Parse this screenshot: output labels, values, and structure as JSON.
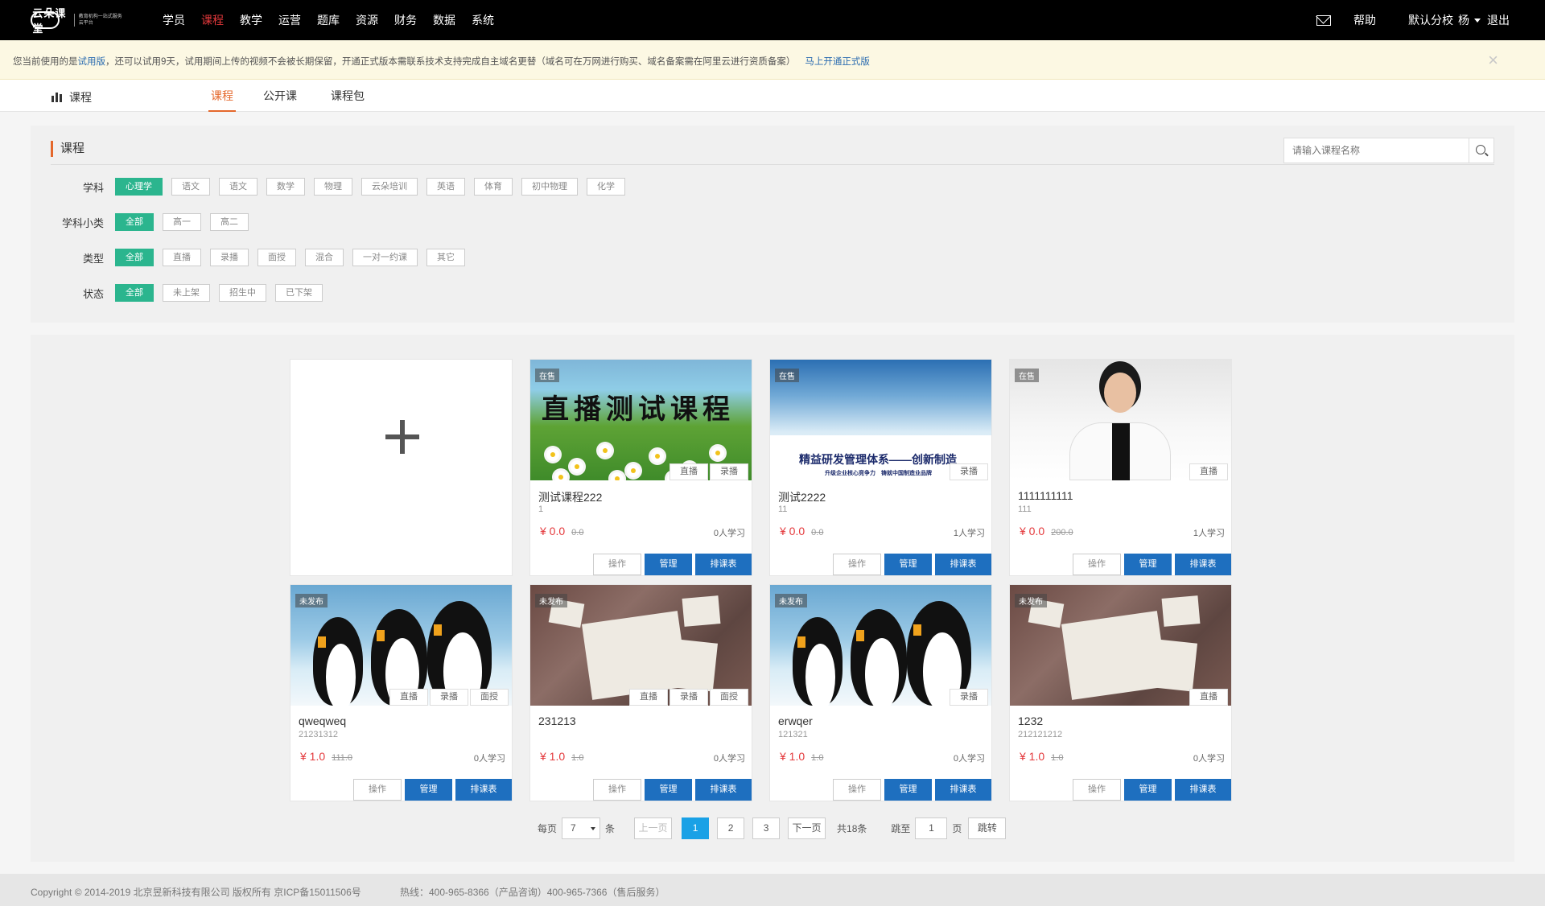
{
  "topbar": {
    "logo_text": "云朵课堂",
    "logo_sub": "教育机构一站式服务云平台",
    "nav": [
      "学员",
      "课程",
      "教学",
      "运营",
      "题库",
      "资源",
      "财务",
      "数据",
      "系统"
    ],
    "nav_active": "课程",
    "help": "帮助",
    "school": "默认分校",
    "user": "杨",
    "logout": "退出"
  },
  "notice": {
    "prefix": "您当前使用的是",
    "trial": "试用版",
    "text": "，还可以试用9天，试用期间上传的视频不会被长期保留，开通正式版本需联系技术支持完成自主域名更替（域名可在万网进行购买、域名备案需在阿里云进行资质备案）",
    "link": "马上开通正式版",
    "close": "×"
  },
  "subnav": {
    "title": "课程",
    "tabs": [
      "课程",
      "公开课",
      "课程包"
    ],
    "active": "课程"
  },
  "filter": {
    "title": "课程",
    "search_placeholder": "请输入课程名称",
    "rows": [
      {
        "label": "学科",
        "tags": [
          "心理学",
          "语文",
          "语文",
          "数学",
          "物理",
          "云朵培训",
          "英语",
          "体育",
          "初中物理",
          "化学"
        ],
        "active": 0
      },
      {
        "label": "学科小类",
        "tags": [
          "全部",
          "高一",
          "高二"
        ],
        "active": 0
      },
      {
        "label": "类型",
        "tags": [
          "全部",
          "直播",
          "录播",
          "面授",
          "混合",
          "一对一约课",
          "其它"
        ],
        "active": 0
      },
      {
        "label": "状态",
        "tags": [
          "全部",
          "未上架",
          "招生中",
          "已下架"
        ],
        "active": 0
      }
    ]
  },
  "courses": [
    {
      "name": "测试课程222",
      "sub": "1",
      "status": "在售",
      "tags": [
        "直播",
        "录播"
      ],
      "price": "¥ 0.0",
      "orig_price": "0.0",
      "learners": "0人学习",
      "art": "green",
      "banner": "直播测试课程"
    },
    {
      "name": "测试2222",
      "sub": "11",
      "status": "在售",
      "tags": [
        "录播"
      ],
      "price": "¥ 0.0",
      "orig_price": "0.0",
      "learners": "1人学习",
      "art": "sky",
      "banner": "精益研发管理体系——创新制造",
      "banner_sub": "升级企业核心竞争力　铸就中国制造业品牌"
    },
    {
      "name": "1111111111",
      "sub": "111",
      "status": "在售",
      "tags": [
        "直播"
      ],
      "price": "¥ 0.0",
      "orig_price": "200.0",
      "learners": "1人学习",
      "art": "woman"
    },
    {
      "name": "qweqweq",
      "sub": "21231312",
      "status": "未发布",
      "tags": [
        "直播",
        "录播",
        "面授"
      ],
      "price": "¥ 1.0",
      "orig_price": "111.0",
      "learners": "0人学习",
      "art": "penguin"
    },
    {
      "name": "231213",
      "sub": "",
      "status": "未发布",
      "tags": [
        "直播",
        "录播",
        "面授"
      ],
      "price": "¥ 1.0",
      "orig_price": "1.0",
      "learners": "0人学习",
      "art": "desk"
    },
    {
      "name": "erwqer",
      "sub": "121321",
      "status": "未发布",
      "tags": [
        "录播"
      ],
      "price": "¥ 1.0",
      "orig_price": "1.0",
      "learners": "0人学习",
      "art": "penguin"
    },
    {
      "name": "1232",
      "sub": "212121212",
      "status": "未发布",
      "tags": [
        "直播"
      ],
      "price": "¥ 1.0",
      "orig_price": "1.0",
      "learners": "0人学习",
      "art": "desk"
    }
  ],
  "card_actions": {
    "operate": "操作",
    "manage": "管理",
    "schedule": "排课表"
  },
  "pager": {
    "per_page_label": "每页",
    "per_page": "7",
    "unit": "条",
    "prev": "上一页",
    "pages": [
      "1",
      "2",
      "3"
    ],
    "current": "1",
    "next": "下一页",
    "total": "共18条",
    "jump_label": "跳至",
    "jump_value": "1",
    "page_unit": "页",
    "jump_btn": "跳转"
  },
  "footer": {
    "copyright": "Copyright © 2014-2019 北京昱新科技有限公司 版权所有 京ICP备15011506号",
    "hotline": "热线：400-965-8366（产品咨询）400-965-7366（售后服务）"
  },
  "colors": {
    "accent_green": "#2bb58e",
    "primary_blue": "#1e6fbf",
    "active_orange": "#e4672b",
    "price_red": "#e4393c",
    "page_active": "#1aa1e6"
  }
}
